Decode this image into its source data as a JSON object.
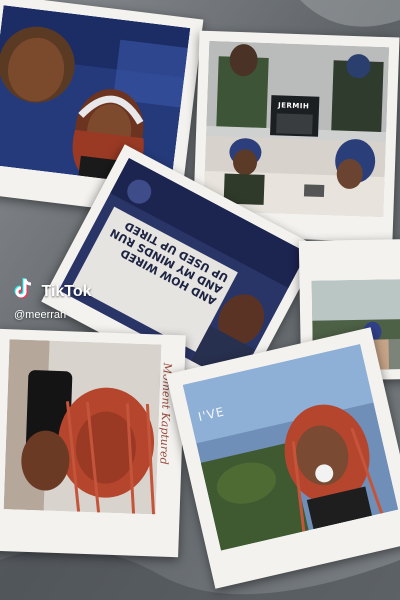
{
  "watermark": {
    "app_name": "TikTok",
    "handle": "@meerrah"
  },
  "photo_texts": {
    "album_title": "JERMIH",
    "book_cover": "AND HOW WIRED AND MY MINDS RUN UP USED UP TIRED",
    "polaroid_caption": "Moment Kaptured",
    "photo_caption": "I'VE"
  },
  "colors": {
    "polaroid_frame": "#f3f2ef",
    "background_fabric": "#6f7478",
    "braids": "#b5452d"
  }
}
